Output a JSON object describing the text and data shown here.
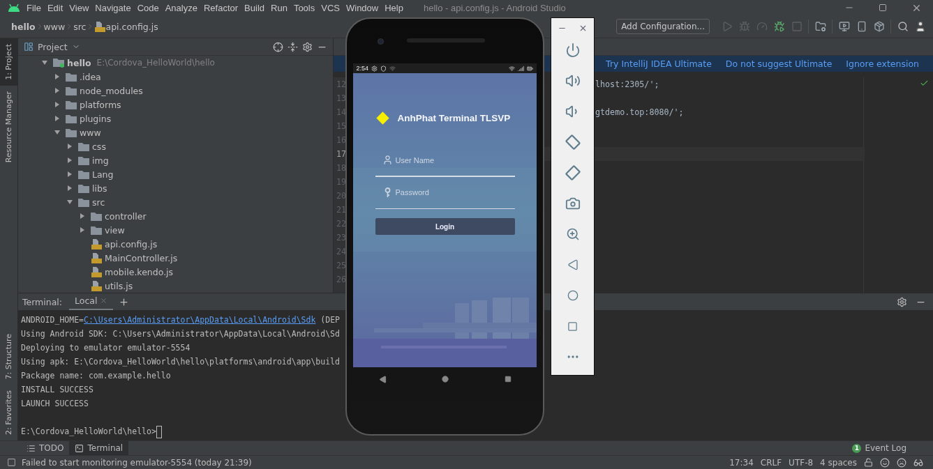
{
  "menu_bar": {
    "menus": [
      "File",
      "Edit",
      "View",
      "Navigate",
      "Code",
      "Analyze",
      "Refactor",
      "Build",
      "Run",
      "Tools",
      "VCS",
      "Window",
      "Help"
    ],
    "title": "hello - api.config.js - Android Studio"
  },
  "breadcrumb": [
    "hello",
    "www",
    "src",
    "api.config.js"
  ],
  "toolbar": {
    "run_configuration": "Add Configuration...",
    "buttons": [
      {
        "kind": "run",
        "disabled": true
      },
      {
        "kind": "debug",
        "disabled": true
      },
      {
        "kind": "profile",
        "disabled": true
      },
      {
        "kind": "apply",
        "disabled": false
      },
      {
        "kind": "stop",
        "disabled": true
      },
      {
        "kind": "structure",
        "disabled": false
      },
      {
        "kind": "avd",
        "disabled": false
      },
      {
        "kind": "device",
        "disabled": false
      },
      {
        "kind": "sdk",
        "disabled": false
      }
    ]
  },
  "tool_windows_top": [
    {
      "label": "1: Project",
      "selected": true
    },
    {
      "label": "Resource Manager",
      "selected": false
    }
  ],
  "tool_windows_bottom": [
    {
      "label": "7: Structure",
      "selected": false
    },
    {
      "label": "2: Favorites",
      "selected": false
    }
  ],
  "project_panel": {
    "title": "Project",
    "tree": [
      {
        "name": "hello",
        "path": "E:\\Cordova_HelloWorld\\hello",
        "kind": "module",
        "expanded": true,
        "children": [
          {
            "name": ".idea",
            "kind": "folder",
            "expanded": false
          },
          {
            "name": "node_modules",
            "kind": "folder",
            "expanded": false
          },
          {
            "name": "platforms",
            "kind": "folder",
            "expanded": false
          },
          {
            "name": "plugins",
            "kind": "folder",
            "expanded": false
          },
          {
            "name": "www",
            "kind": "folder",
            "expanded": true,
            "children": [
              {
                "name": "css",
                "kind": "folder",
                "expanded": false
              },
              {
                "name": "img",
                "kind": "folder",
                "expanded": false
              },
              {
                "name": "Lang",
                "kind": "folder",
                "expanded": false
              },
              {
                "name": "libs",
                "kind": "folder",
                "expanded": false
              },
              {
                "name": "src",
                "kind": "folder",
                "expanded": true,
                "children": [
                  {
                    "name": "controller",
                    "kind": "folder",
                    "expanded": false
                  },
                  {
                    "name": "view",
                    "kind": "folder",
                    "expanded": false
                  },
                  {
                    "name": "api.config.js",
                    "kind": "file"
                  },
                  {
                    "name": "MainController.js",
                    "kind": "file"
                  },
                  {
                    "name": "mobile.kendo.js",
                    "kind": "file"
                  },
                  {
                    "name": "utils.js",
                    "kind": "file"
                  }
                ]
              }
            ]
          }
        ]
      }
    ]
  },
  "editor": {
    "banner_links": [
      "Try IntelliJ IDEA Ultimate",
      "Do not suggest Ultimate",
      "Ignore extension"
    ],
    "lines": [
      {
        "number": "12",
        "text": "lhost:2305/';",
        "current": false
      },
      {
        "number": "13",
        "current": false
      },
      {
        "number": "14",
        "text": "gtdemo.top:8080/';",
        "current": false
      },
      {
        "number": "15",
        "current": false
      },
      {
        "number": "16",
        "current": false
      },
      {
        "number": "17",
        "current": true
      },
      {
        "number": "18",
        "current": false
      },
      {
        "number": "19",
        "current": false
      },
      {
        "number": "20",
        "current": false
      },
      {
        "number": "21",
        "current": false
      },
      {
        "number": "22",
        "current": false
      },
      {
        "number": "23",
        "current": false
      },
      {
        "number": "24",
        "current": false
      },
      {
        "number": "25",
        "current": false
      },
      {
        "number": "26",
        "current": false
      }
    ]
  },
  "terminal": {
    "title": "Terminal:",
    "tabs": [
      {
        "label": "Local",
        "selected": true
      }
    ],
    "lines": [
      {
        "parts": [
          {
            "kind": "text",
            "text": "ANDROID_HOME="
          },
          {
            "kind": "link",
            "text": "C:\\Users\\Administrator\\AppData\\Local\\Android\\Sdk"
          },
          {
            "kind": "text",
            "text": " (DEP"
          }
        ]
      },
      {
        "parts": [
          {
            "kind": "text",
            "text": "Using Android SDK: C:\\Users\\Administrator\\AppData\\Local\\Android\\Sd"
          }
        ]
      },
      {
        "parts": [
          {
            "kind": "text",
            "text": "Deploying to emulator emulator-5554"
          }
        ]
      },
      {
        "parts": [
          {
            "kind": "text",
            "text": "Using apk: E:\\Cordova_HelloWorld\\hello\\platforms\\android\\app\\build"
          }
        ]
      },
      {
        "parts": [
          {
            "kind": "text",
            "text": "Package name: com.example.hello"
          }
        ]
      },
      {
        "parts": [
          {
            "kind": "text",
            "text": "INSTALL SUCCESS"
          }
        ]
      },
      {
        "parts": [
          {
            "kind": "text",
            "text": "LAUNCH SUCCESS"
          }
        ]
      }
    ],
    "prompt": "E:\\Cordova_HelloWorld\\hello>"
  },
  "emulator": {
    "status_time": "2:54",
    "app": {
      "title": "AnhPhat Terminal TLSVP",
      "username_placeholder": "User Name",
      "password_placeholder": "Password",
      "login_button": "Login"
    }
  },
  "bottom_tabs": [
    {
      "label": "TODO",
      "kind": "todo",
      "selected": false
    },
    {
      "label": "Terminal",
      "kind": "terminal",
      "selected": true
    }
  ],
  "event_log": {
    "label": "Event Log",
    "count": "1"
  },
  "status_bar": {
    "message": "Failed to start monitoring emulator-5554 (today 21:39)",
    "items": [
      "17:34",
      "CRLF",
      "UTF-8",
      "4 spaces"
    ]
  }
}
